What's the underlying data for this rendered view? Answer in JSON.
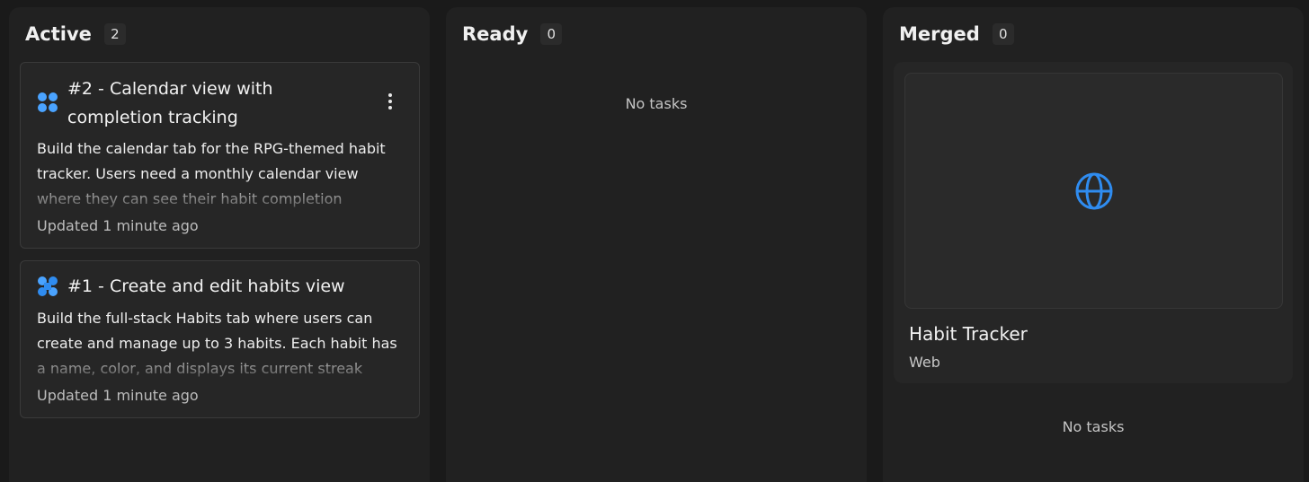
{
  "columns": {
    "active": {
      "title": "Active",
      "count": "2",
      "tasks": [
        {
          "title": "#2 - Calendar view with completion tracking",
          "description": "Build the calendar tab for the RPG-themed habit tracker. Users need a monthly calendar view where they can see their habit completion progress at a",
          "updated": "Updated 1 minute ago",
          "icon": "agent-dots-icon",
          "has_menu": true
        },
        {
          "title": "#1 - Create and edit habits view",
          "description": "Build the full-stack Habits tab where users can create and manage up to 3 habits. Each habit has a name, color, and displays its current streak count.",
          "updated": "Updated 1 minute ago",
          "icon": "agent-spinner-icon",
          "has_menu": false
        }
      ]
    },
    "ready": {
      "title": "Ready",
      "count": "0",
      "empty_text": "No tasks"
    },
    "merged": {
      "title": "Merged",
      "count": "0",
      "project": {
        "name": "Habit Tracker",
        "type": "Web",
        "icon": "globe-icon"
      },
      "empty_text": "No tasks"
    }
  },
  "colors": {
    "accent": "#2f8cf0",
    "background": "#1a1a1a",
    "column": "#212121",
    "card": "#262626"
  }
}
